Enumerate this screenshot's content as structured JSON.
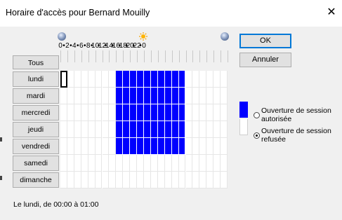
{
  "window": {
    "title": "Horaire d'accès pour Bernard Mouilly",
    "close_glyph": "✕"
  },
  "hour_labels": [
    "0",
    "•",
    "2",
    "•",
    "4",
    "•",
    "6",
    "•",
    "8",
    "•",
    "10",
    "•",
    "12",
    "•",
    "14",
    "•",
    "16",
    "•",
    "18",
    "•",
    "20",
    "•",
    "22",
    "•",
    "0"
  ],
  "grid": {
    "all_label": "Tous",
    "days": [
      "lundi",
      "mardi",
      "mercredi",
      "jeudi",
      "vendredi",
      "samedi",
      "dimanche"
    ],
    "allowed": [
      {
        "days": [
          0,
          1,
          2,
          3,
          4
        ],
        "from_hour": 8,
        "to_hour": 18
      }
    ],
    "selected_cell": {
      "day": 0,
      "hour": 0
    },
    "colors": {
      "allowed": "#0000ff",
      "denied": "#ffffff"
    }
  },
  "buttons": {
    "ok": "OK",
    "cancel": "Annuler"
  },
  "legend": {
    "allowed_label_1": "Ouverture de session",
    "allowed_label_2": "autorisée",
    "denied_label_1": "Ouverture de session",
    "denied_label_2": "refusée",
    "selected": "denied"
  },
  "status": "Le lundi, de 00:00 à 01:00",
  "icons": {
    "night_start": "moon-icon",
    "noon": "sun-icon",
    "night_end": "moon-icon"
  }
}
